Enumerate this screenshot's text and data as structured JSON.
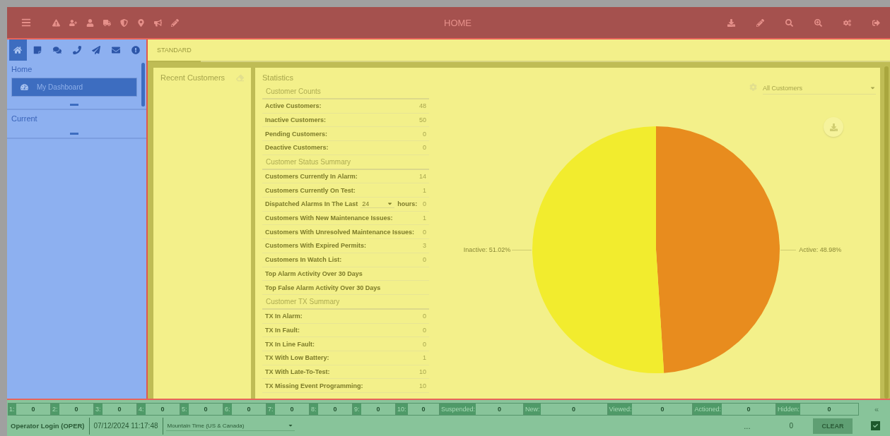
{
  "header": {
    "title": "HOME"
  },
  "sidebar": {
    "tabs": [
      {
        "selected": true
      },
      {
        "selected": false
      },
      {
        "selected": false
      },
      {
        "selected": false
      },
      {
        "selected": false
      },
      {
        "selected": false
      },
      {
        "selected": false
      }
    ],
    "sections": [
      {
        "title": "Home",
        "items": [
          {
            "label": "My Dashboard",
            "selected": true
          }
        ]
      },
      {
        "title": "Current"
      }
    ]
  },
  "tabs": [
    {
      "label": "STANDARD",
      "selected": true
    }
  ],
  "recent_customers": {
    "title": "Recent Customers"
  },
  "statistics": {
    "title": "Statistics",
    "filter": "All Customers",
    "sections": [
      {
        "title": "Customer Counts",
        "rows": [
          {
            "kind": "stat",
            "label": "Active Customers:",
            "value": "48"
          },
          {
            "kind": "stat",
            "label": "Inactive Customers:",
            "value": "50"
          },
          {
            "kind": "stat",
            "label": "Pending Customers:",
            "value": "0"
          },
          {
            "kind": "stat",
            "label": "Deactive Customers:",
            "value": "0"
          }
        ]
      },
      {
        "title": "Customer Status Summary",
        "rows": [
          {
            "kind": "stat",
            "label": "Customers Currently In Alarm:",
            "value": "14"
          },
          {
            "kind": "stat",
            "label": "Customers Currently On Test:",
            "value": "1"
          },
          {
            "kind": "dispatch",
            "label": "Dispatched Alarms In The Last",
            "select": "24",
            "suffix": "hours:",
            "value": "0"
          },
          {
            "kind": "stat",
            "label": "Customers With New Maintenance Issues:",
            "value": "1"
          },
          {
            "kind": "stat",
            "label": "Customers With Unresolved Maintenance Issues:",
            "value": "0"
          },
          {
            "kind": "stat",
            "label": "Customers With Expired Permits:",
            "value": "3"
          },
          {
            "kind": "stat",
            "label": "Customers In Watch List:",
            "value": "0"
          },
          {
            "kind": "link",
            "label": "Top Alarm Activity Over 30 Days"
          },
          {
            "kind": "link",
            "label": "Top False Alarm Activity Over 30 Days"
          }
        ]
      },
      {
        "title": "Customer TX Summary",
        "rows": [
          {
            "kind": "stat",
            "label": "TX In Alarm:",
            "value": "0"
          },
          {
            "kind": "stat",
            "label": "TX In Fault:",
            "value": "0"
          },
          {
            "kind": "stat",
            "label": "TX In Line Fault:",
            "value": "0"
          },
          {
            "kind": "stat",
            "label": "TX With Low Battery:",
            "value": "1"
          },
          {
            "kind": "stat",
            "label": "TX With Late-To-Test:",
            "value": "10"
          },
          {
            "kind": "stat",
            "label": "TX Missing Event Programming:",
            "value": "10"
          }
        ]
      }
    ],
    "chart_data": {
      "type": "pie",
      "values": [
        48.98,
        51.02
      ],
      "colors": [
        "#e88c1e",
        "#f2ec2e"
      ],
      "value_labels": [
        "Active: 48.98%",
        "Inactive: 51.02%"
      ]
    }
  },
  "footer": {
    "counters": [
      {
        "label": "1:",
        "value": "0"
      },
      {
        "label": "2:",
        "value": "0"
      },
      {
        "label": "3:",
        "value": "0"
      },
      {
        "label": "4:",
        "value": "0"
      },
      {
        "label": "5:",
        "value": "0"
      },
      {
        "label": "6:",
        "value": "0"
      },
      {
        "label": "7:",
        "value": "0"
      },
      {
        "label": "8:",
        "value": "0"
      },
      {
        "label": "9:",
        "value": "0"
      },
      {
        "label": "10:",
        "value": "0"
      }
    ],
    "statuses": [
      {
        "label": "Suspended:",
        "value": "0"
      },
      {
        "label": "New:",
        "value": "0"
      },
      {
        "label": "Viewed:",
        "value": "0"
      },
      {
        "label": "Actioned:",
        "value": "0"
      },
      {
        "label": "Hidden:",
        "value": "0"
      }
    ],
    "collapse": "«",
    "operator": "Operator Login (OPER)",
    "datetime": "07/12/2024 11:17:48",
    "timezone": "Mountain Time (US & Canada)",
    "ellipsis": "...",
    "count": "0",
    "clear": "CLEAR",
    "checked": true
  }
}
